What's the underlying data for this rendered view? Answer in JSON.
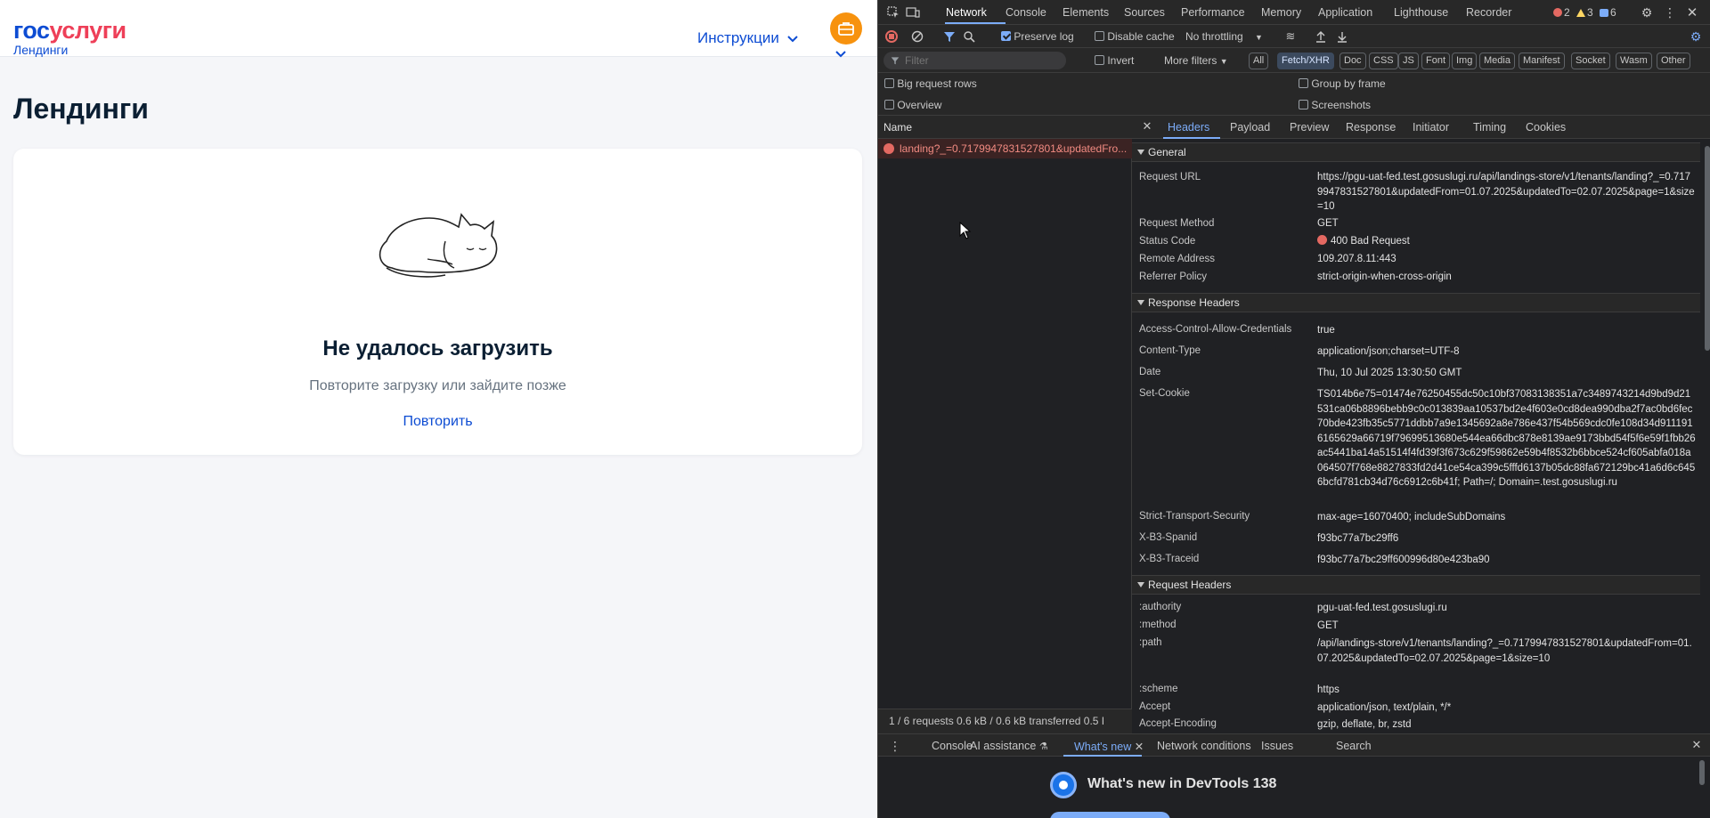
{
  "site": {
    "logo_part1": "гос",
    "logo_part2": "услуги",
    "logo_sub": "Лендинги",
    "nav_instructions": "Инструкции",
    "briefcase_icon": "briefcase-icon",
    "page_title": "Лендинги",
    "error_title": "Не удалось загрузить",
    "error_subtitle": "Повторите загрузку или зайдите позже",
    "retry": "Повторить",
    "colors": {
      "brand_blue": "#0d4cd3",
      "brand_red": "#ee3f58",
      "briefcase": "#f7920e"
    }
  },
  "devtools": {
    "tabs": [
      "Network",
      "Console",
      "Elements",
      "Sources",
      "Performance",
      "Memory",
      "Application",
      "Lighthouse",
      "Recorder"
    ],
    "active_tab": "Network",
    "counts": {
      "errors": "2",
      "warnings": "3",
      "messages": "6"
    },
    "toolbar": {
      "preserve_log": "Preserve log",
      "disable_cache": "Disable cache",
      "throttling": "No throttling"
    },
    "filter": {
      "placeholder": "Filter",
      "invert": "Invert",
      "more_filters": "More filters",
      "chips": [
        "All",
        "Fetch/XHR",
        "Doc",
        "CSS",
        "JS",
        "Font",
        "Img",
        "Media",
        "Manifest",
        "Socket",
        "Wasm",
        "Other"
      ],
      "active_chip": "Fetch/XHR"
    },
    "settings": {
      "big_request_rows": "Big request rows",
      "group_by_frame": "Group by frame",
      "overview": "Overview",
      "screenshots": "Screenshots"
    },
    "request_list": {
      "header": "Name",
      "row": "landing?_=0.7179947831527801&updatedFro...",
      "status_bar": "1 / 6 requests    0.6 kB / 0.6 kB transferred    0.5 I"
    },
    "detail_tabs": [
      "Headers",
      "Payload",
      "Preview",
      "Response",
      "Initiator",
      "Timing",
      "Cookies"
    ],
    "active_detail_tab": "Headers",
    "general": {
      "title": "General",
      "request_url_k": "Request URL",
      "request_url_v": "https://pgu-uat-fed.test.gosuslugi.ru/api/landings-store/v1/tenants/landing?_=0.7179947831527801&updatedFrom=01.07.2025&updatedTo=02.07.2025&page=1&size=10",
      "method_k": "Request Method",
      "method_v": "GET",
      "status_k": "Status Code",
      "status_v": "400 Bad Request",
      "remote_k": "Remote Address",
      "remote_v": "109.207.8.11:443",
      "referrer_k": "Referrer Policy",
      "referrer_v": "strict-origin-when-cross-origin"
    },
    "response_headers": {
      "title": "Response Headers",
      "acac_k": "Access-Control-Allow-Credentials",
      "acac_v": "true",
      "ct_k": "Content-Type",
      "ct_v": "application/json;charset=UTF-8",
      "date_k": "Date",
      "date_v": "Thu, 10 Jul 2025 13:30:50 GMT",
      "cookie_k": "Set-Cookie",
      "cookie_v": "TS014b6e75=01474e76250455dc50c10bf37083138351a7c3489743214d9bd9d21531ca06b8896bebb9c0c013839aa10537bd2e4f603e0cd8dea990dba2f7ac0bd6fec70bde423fb35c5771ddbb7a9e1345692a8e786e437f54b569cdc0fe108d34d9111916165629a66719f79699513680e544ea66dbc878e8139ae9173bbd54f5f6e59f1fbb26ac5441ba14a51514f4fd39f3f673c629f59862e59b4f8532b6bbce524cf605abfa018a064507f768e8827833fd2d41ce54ca399c5fffd6137b05dc88fa672129bc41a6d6c6456bcfd781cb34d76c6912c6b41f; Path=/; Domain=.test.gosuslugi.ru",
      "sts_k": "Strict-Transport-Security",
      "sts_v": "max-age=16070400; includeSubDomains",
      "spanid_k": "X-B3-Spanid",
      "spanid_v": "f93bc77a7bc29ff6",
      "traceid_k": "X-B3-Traceid",
      "traceid_v": "f93bc77a7bc29ff600996d80e423ba90"
    },
    "request_headers": {
      "title": "Request Headers",
      "authority_k": ":authority",
      "authority_v": "pgu-uat-fed.test.gosuslugi.ru",
      "method_k": ":method",
      "method_v": "GET",
      "path_k": ":path",
      "path_v": "/api/landings-store/v1/tenants/landing?_=0.7179947831527801&updatedFrom=01.07.2025&updatedTo=02.07.2025&page=1&size=10",
      "scheme_k": ":scheme",
      "scheme_v": "https",
      "accept_k": "Accept",
      "accept_v": "application/json, text/plain, */*",
      "encoding_k": "Accept-Encoding",
      "encoding_v": "gzip, deflate, br, zstd"
    },
    "drawer": {
      "tabs": [
        "Console",
        "AI assistance",
        "What's new",
        "Network conditions",
        "Issues",
        "Search"
      ],
      "active": "What's new",
      "whats_new_title": "What's new in DevTools 138"
    }
  }
}
